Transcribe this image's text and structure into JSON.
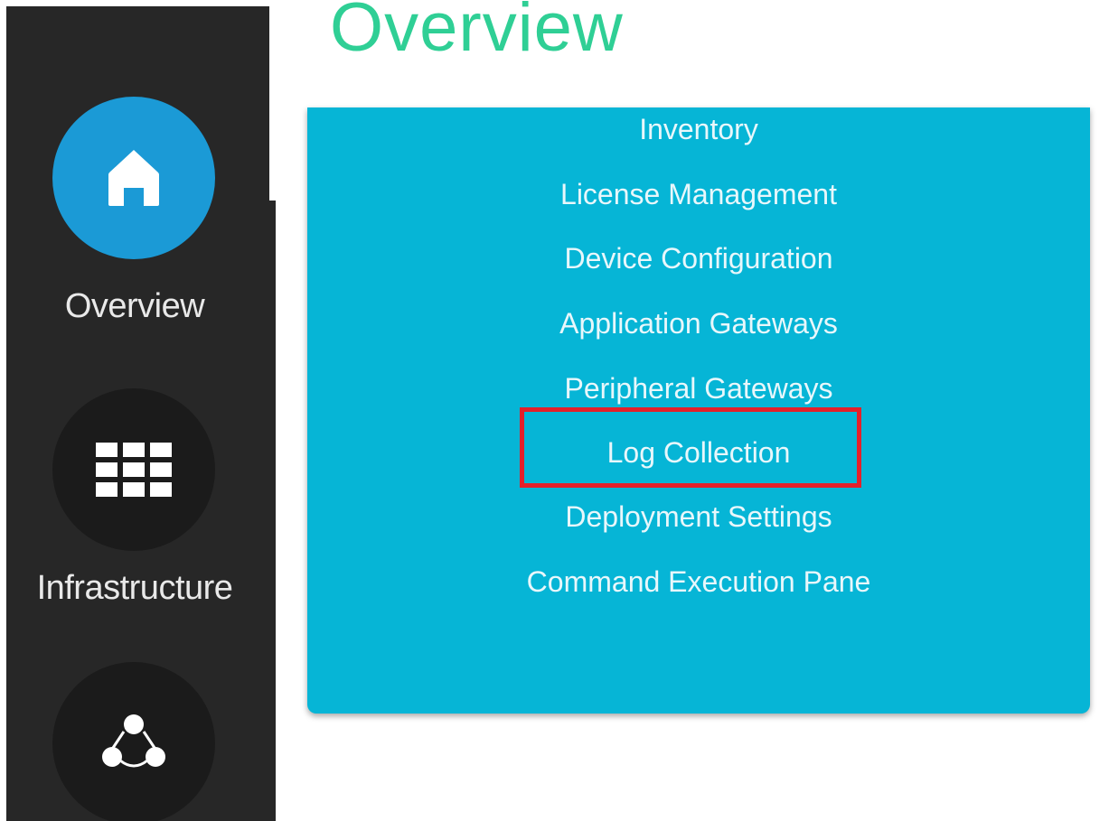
{
  "page": {
    "title": "Overview"
  },
  "sidebar": {
    "items": [
      {
        "label": "Overview",
        "icon": "home-icon",
        "active": true
      },
      {
        "label": "Infrastructure",
        "icon": "grid-icon",
        "active": false
      },
      {
        "label": "",
        "icon": "network-icon",
        "active": false
      }
    ]
  },
  "menu": {
    "items": [
      "Inventory",
      "License Management",
      "Device Configuration",
      "Application Gateways",
      "Peripheral Gateways",
      "Log Collection",
      "Deployment Settings",
      "Command Execution Pane"
    ],
    "highlighted_item": "Log Collection"
  },
  "colors": {
    "sidebar_bg": "#272727",
    "active_circle": "#1b9ad6",
    "title_green": "#2fcf95",
    "panel_cyan": "#06b5d6",
    "highlight_red": "#e4202a"
  }
}
